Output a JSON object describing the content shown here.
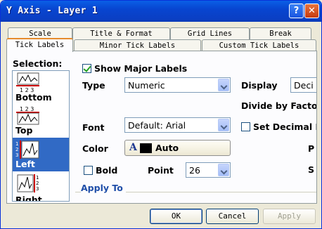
{
  "window": {
    "title": "Y Axis - Layer 1"
  },
  "tabs_back": [
    "Scale",
    "Title & Format",
    "Grid Lines",
    "Break"
  ],
  "tabs_front": [
    "Tick Labels",
    "Minor Tick Labels",
    "Custom Tick Labels"
  ],
  "active_tab": "Tick Labels",
  "selection": {
    "label": "Selection:",
    "items": [
      {
        "name": "Bottom",
        "ticks": "1 2 3"
      },
      {
        "name": "Top",
        "ticks": "1 2 3"
      },
      {
        "name": "Left",
        "ticks": "1 2 3"
      },
      {
        "name": "Right",
        "ticks": "1 2 3"
      }
    ],
    "selected": "Left"
  },
  "show_major_labels": {
    "label": "Show Major Labels",
    "checked": true
  },
  "type": {
    "label": "Type",
    "value": "Numeric"
  },
  "display": {
    "label": "Display",
    "value": "Deci"
  },
  "divide_by_factor": {
    "label": "Divide by Factor"
  },
  "font": {
    "label": "Font",
    "value": "Default: Arial"
  },
  "set_decimal": {
    "label": "Set Decimal P",
    "checked": false
  },
  "color": {
    "label": "Color",
    "glyph": "A",
    "value": "Auto",
    "swatch": "#000000"
  },
  "bold": {
    "label": "Bold",
    "checked": false
  },
  "point": {
    "label": "Point",
    "value": "26"
  },
  "side_letters": [
    "P",
    "S"
  ],
  "apply_to": {
    "label": "Apply To"
  },
  "buttons": {
    "ok": "OK",
    "cancel": "Cancel",
    "apply": "Apply"
  },
  "colors": {
    "titlebar": "#0a4fd6",
    "accent": "#316ac5",
    "section_header": "#1f4ea8"
  }
}
